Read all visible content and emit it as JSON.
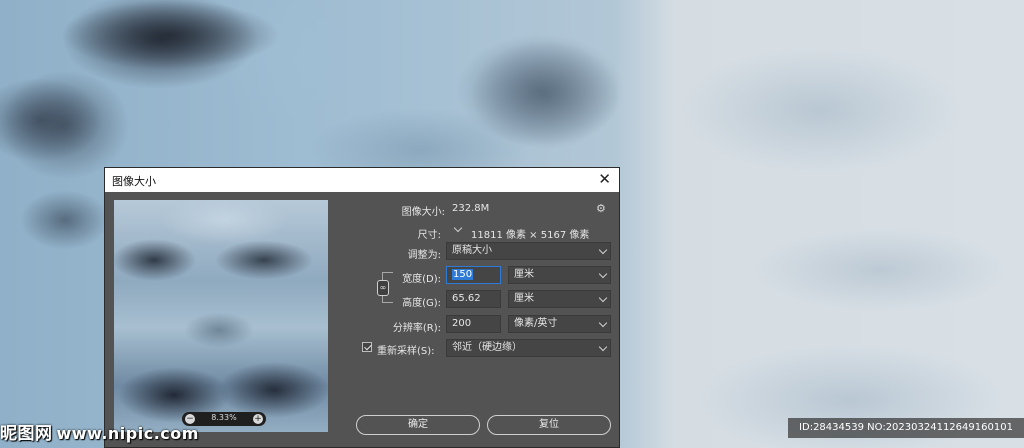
{
  "dialog": {
    "title": "图像大小",
    "close_icon": "close-icon",
    "image_size_label": "图像大小:",
    "image_size_value": "232.8M",
    "settings_icon": "gear-icon",
    "dimensions_label": "尺寸:",
    "dimensions_value": "11811 像素 × 5167 像素",
    "fit_to_label": "调整为:",
    "fit_to_value": "原稿大小",
    "width_label": "宽度(D):",
    "width_value": "150",
    "width_unit": "厘米",
    "height_label": "高度(G):",
    "height_value": "65.62",
    "height_unit": "厘米",
    "resolution_label": "分辨率(R):",
    "resolution_value": "200",
    "resolution_unit": "像素/英寸",
    "resample_label": "重新采样(S):",
    "resample_checked": true,
    "resample_value": "邻近（硬边缘）",
    "zoom_value": "8.33%",
    "ok_label": "确定",
    "reset_label": "复位"
  },
  "watermark": {
    "left_text": "昵图网",
    "left_url": "www.nipic.com",
    "right_text": "ID:28434539 NO:20230324112649160101"
  }
}
